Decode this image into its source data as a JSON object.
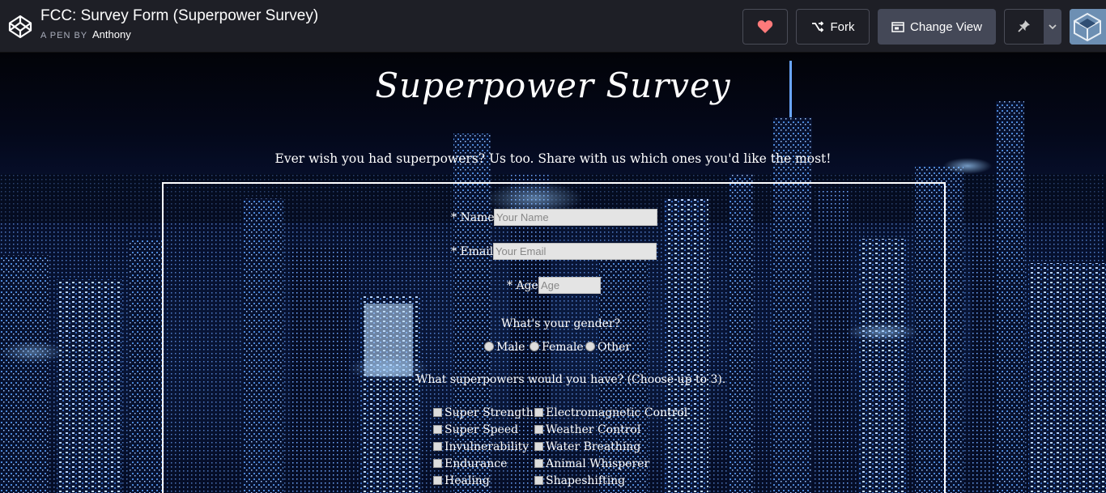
{
  "header": {
    "pen_title": "FCC: Survey Form (Superpower Survey)",
    "byline_prefix": "A PEN BY",
    "author": "Anthony",
    "fork_label": "Fork",
    "change_view_label": "Change View",
    "heart_color": "#ff6b6b"
  },
  "survey": {
    "title": "Superpower Survey",
    "subtitle": "Ever wish you had superpowers? Us too. Share with us which ones you'd like the most!",
    "name_label": "* Name:",
    "name_placeholder": "Your Name",
    "email_label": "* Email:",
    "email_placeholder": "Your Email",
    "age_label": "* Age:",
    "age_placeholder": "Age",
    "gender_question": "What's your gender?",
    "gender_options": [
      "Male",
      "Female",
      "Other"
    ],
    "powers_question": "What superpowers would you have? (Choose up to 3).",
    "powers_left": [
      "Super Strength",
      "Super Speed",
      "Invulnerability",
      "Endurance",
      "Healing"
    ],
    "powers_right": [
      "Electromagnetic Control",
      "Weather Control",
      "Water Breathing",
      "Animal Whisperer",
      "Shapeshifting"
    ]
  }
}
